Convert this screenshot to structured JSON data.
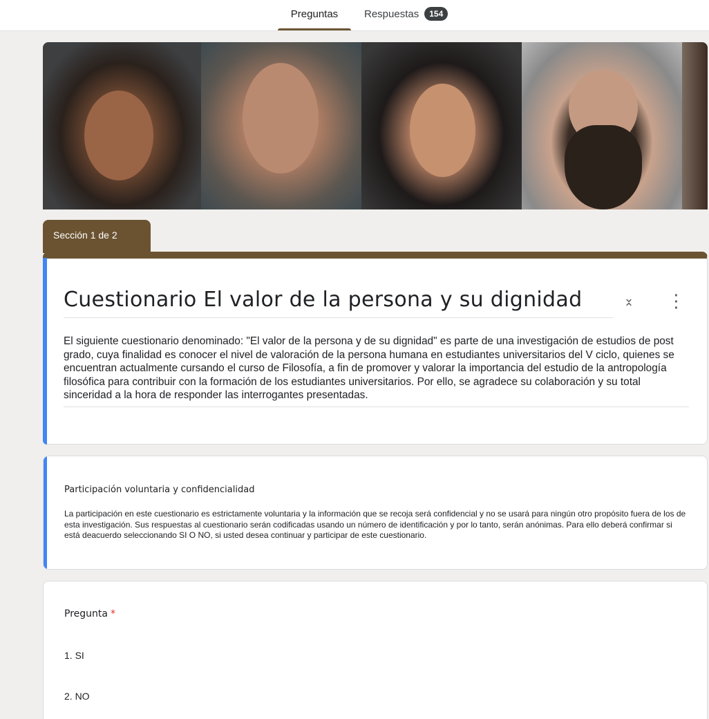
{
  "tabs": {
    "preguntas": "Preguntas",
    "respuestas": "Respuestas",
    "respuestas_count": "154"
  },
  "section": {
    "label": "Sección 1 de 2"
  },
  "form": {
    "title": "Cuestionario El valor de la persona y su dignidad",
    "description": "El siguiente cuestionario denominado: \"El valor de la persona y de su dignidad\" es parte de una investigación de estudios de post grado, cuya  finalidad es conocer  el nivel de valoración de la persona humana en estudiantes universitarios del V ciclo, quienes se encuentran actualmente cursando el curso de Filosofía, a fin  de promover y valorar  la importancia  del estudio de  la  antropología filosófica para contribuir con la formación de los estudiantes universitarios.   Por ello, se agradece  su colaboración y su total sinceridad a la hora de responder las interrogantes presentadas."
  },
  "info": {
    "title": "Participación voluntaria y confidencialidad",
    "body": "La participación en este cuestionario es estrictamente voluntaria y la información que se recoja será confidencial y no se usará para ningún otro propósito fuera de los de esta investigación. Sus respuestas al cuestionario serán codificadas usando un número de identificación y por lo tanto, serán anónimas. Para ello deberá confirmar si está deacuerdo seleccionando SI O NO, si usted desea continuar y participar de este cuestionario."
  },
  "question": {
    "label": "Pregunta",
    "required_mark": "*",
    "options": [
      "1.  SI",
      "2.  NO"
    ]
  },
  "colors": {
    "theme": "#6b5332",
    "accent_bar": "#4285f4",
    "required": "#d93025"
  },
  "icons": {
    "collapse": "collapse-icon",
    "more": "more-vert-icon"
  }
}
